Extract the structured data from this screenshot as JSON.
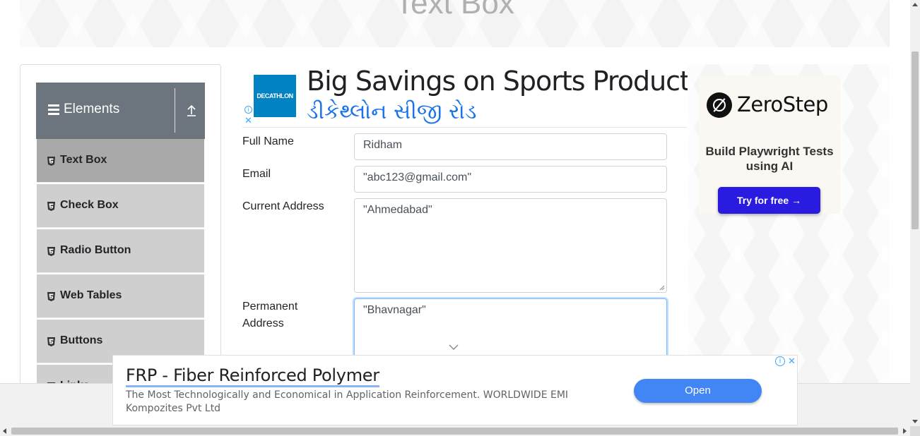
{
  "banner": {
    "title": "Text Box"
  },
  "sidebar": {
    "group_title": "Elements",
    "items": [
      {
        "label": "Text Box",
        "icon": "html5-icon",
        "active": true
      },
      {
        "label": "Check Box",
        "icon": "html5-icon"
      },
      {
        "label": "Radio Button",
        "icon": "html5-icon"
      },
      {
        "label": "Web Tables",
        "icon": "html5-icon"
      },
      {
        "label": "Buttons",
        "icon": "html5-icon"
      },
      {
        "label": "Links",
        "icon": "html5-icon"
      }
    ]
  },
  "top_ad": {
    "logo_text": "DECATHLON",
    "headline": "Big Savings on Sports Products",
    "subline": "ડીકેથ્લોન સીજી રોડ"
  },
  "form": {
    "full_name": {
      "label": "Full Name",
      "value": "Ridham"
    },
    "email": {
      "label": "Email",
      "value": "\"abc123@gmail.com\""
    },
    "current_address": {
      "label": "Current Address",
      "value": "\"Ahmedabad\""
    },
    "permanent_address": {
      "label": "Permanent Address",
      "value": "\"Bhavnagar\""
    }
  },
  "right_ad": {
    "brand": "ZeroStep",
    "tagline": "Build Playwright Tests using AI",
    "cta": "Try for free →"
  },
  "bottom_ad": {
    "title": "FRP - Fiber Reinforced Polymer",
    "description": "The Most Technologically and Economical in Application Reinforcement. WORLDWIDE EMI Kompozites Pvt Ltd",
    "cta": "Open"
  },
  "colors": {
    "sidebar_header": "#6c757d",
    "menu_item": "#cfcfcf",
    "menu_item_active": "#a9a9a9",
    "ad_headline_blue": "#1a73e8",
    "zerostep_button": "#2a1be0",
    "open_button": "#4285f4"
  }
}
